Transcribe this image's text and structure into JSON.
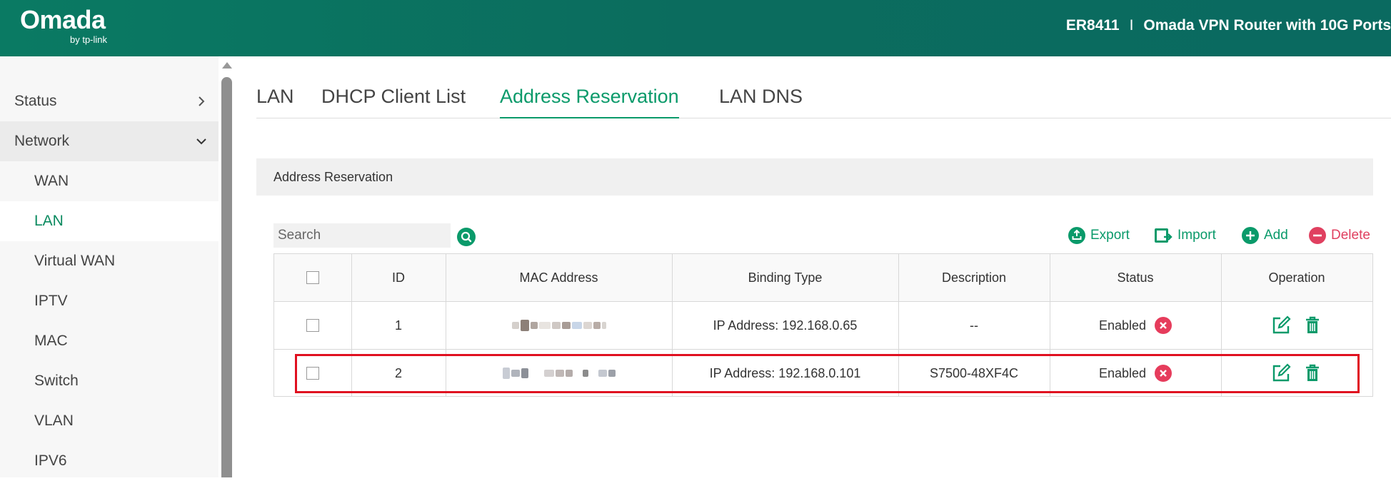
{
  "header": {
    "logo_main": "Omada",
    "logo_sub": "by tp-link",
    "model": "ER8411",
    "separator": "I",
    "description": "Omada VPN Router with 10G Ports"
  },
  "sidebar": {
    "items": [
      {
        "label": "Status"
      },
      {
        "label": "Network"
      },
      {
        "label": "WAN"
      },
      {
        "label": "LAN"
      },
      {
        "label": "Virtual WAN"
      },
      {
        "label": "IPTV"
      },
      {
        "label": "MAC"
      },
      {
        "label": "Switch"
      },
      {
        "label": "VLAN"
      },
      {
        "label": "IPV6"
      }
    ]
  },
  "tabs": [
    "LAN",
    "DHCP Client List",
    "Address Reservation",
    "LAN DNS"
  ],
  "active_tab": "Address Reservation",
  "section": {
    "title": "Address Reservation"
  },
  "toolbar": {
    "search_placeholder": "Search",
    "export": "Export",
    "import": "Import",
    "add": "Add",
    "delete": "Delete"
  },
  "table": {
    "headers": [
      "ID",
      "MAC Address",
      "Binding Type",
      "Description",
      "Status",
      "Operation"
    ],
    "rows": [
      {
        "id": "1",
        "mac": "",
        "binding": "IP Address: 192.168.0.65",
        "description": "--",
        "status": "Enabled"
      },
      {
        "id": "2",
        "mac": "",
        "binding": "IP Address: 192.168.0.101",
        "description": "S7500-48XF4C",
        "status": "Enabled"
      }
    ]
  },
  "colors": {
    "header_bg": "#0b6c5e",
    "accent": "#0a9a6a",
    "danger": "#e04060",
    "highlight": "#e01020"
  }
}
